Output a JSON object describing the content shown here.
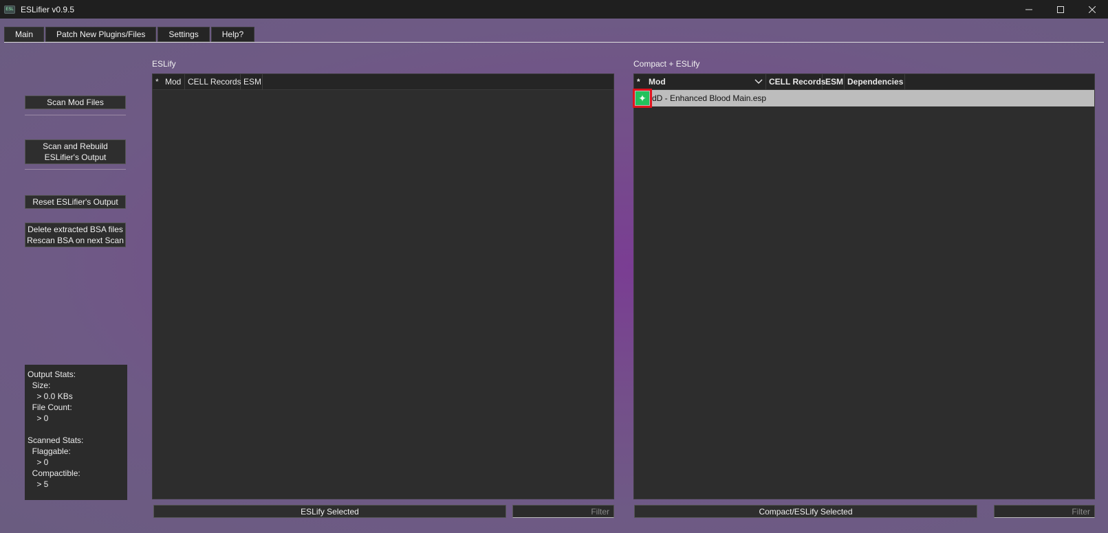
{
  "window": {
    "title": "ESLifier v0.9.5",
    "icon_label": "ESL"
  },
  "tabs": [
    {
      "label": "Main",
      "active": true
    },
    {
      "label": "Patch New Plugins/Files",
      "active": false
    },
    {
      "label": "Settings",
      "active": false
    },
    {
      "label": "Help?",
      "active": false
    }
  ],
  "sidebar": {
    "scan_mod_files": "Scan Mod Files",
    "scan_rebuild_line1": "Scan and Rebuild",
    "scan_rebuild_line2": "ESLifier's Output",
    "reset_output": "Reset ESLifier's Output",
    "delete_bsa_line1": "Delete extracted BSA files",
    "delete_bsa_line2": "Rescan BSA on next Scan"
  },
  "stats": {
    "output_header": "Output Stats:",
    "size_label": "  Size:",
    "size_value": "    > 0.0 KBs",
    "file_count_label": "  File Count:",
    "file_count_value": "    > 0",
    "scanned_header": "Scanned Stats:",
    "flaggable_label": "  Flaggable:",
    "flaggable_value": "    > 0",
    "compactible_label": "  Compactible:",
    "compactible_value": "    > 5"
  },
  "eslify_panel": {
    "title": "ESLify",
    "columns": [
      "*",
      "Mod",
      "CELL Records",
      "ESM"
    ],
    "action_button": "ESLify Selected",
    "filter_placeholder": "Filter"
  },
  "compact_panel": {
    "title": "Compact + ESLify",
    "columns": [
      "*",
      "Mod",
      "CELL Records",
      "ESM",
      "Dependencies"
    ],
    "rows": [
      {
        "mod": "dD - Enhanced Blood Main.esp",
        "selected": true,
        "status_icon": "sparkle-icon"
      }
    ],
    "action_button": "Compact/ESLify Selected",
    "filter_placeholder": "Filter"
  },
  "colors": {
    "accent_green": "#22c15c",
    "highlight_red": "#e0141e"
  }
}
